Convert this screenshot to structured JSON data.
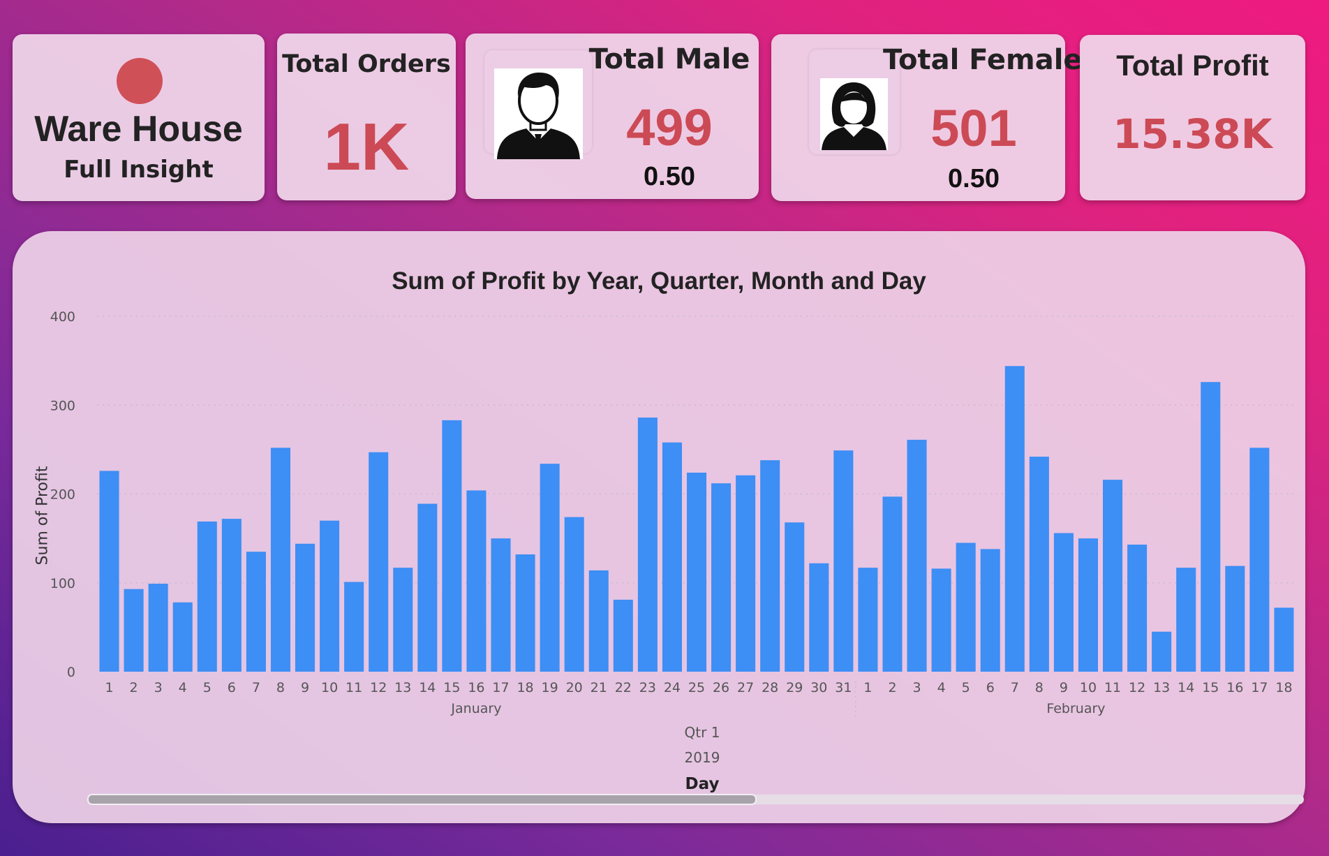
{
  "cards": {
    "warehouse": {
      "title": "Ware House",
      "subtitle": "Full Insight"
    },
    "orders": {
      "label": "Total Orders",
      "value": "1K"
    },
    "male": {
      "label": "Total Male",
      "value": "499",
      "ratio": "0.50"
    },
    "female": {
      "label": "Total Female",
      "value": "501",
      "ratio": "0.50"
    },
    "profit": {
      "label": "Total Profit",
      "value": "15.38K"
    }
  },
  "colors": {
    "accent": "#cc4a55",
    "bar": "#3d8ef5"
  },
  "icons": {
    "logo": "red-circle-icon",
    "male": "man-avatar-icon",
    "female": "woman-avatar-icon"
  },
  "chart_data": {
    "type": "bar",
    "title": "Sum of Profit by Year, Quarter, Month and Day",
    "ylabel": "Sum of Profit",
    "xlabel": "Day",
    "ylim": [
      0,
      400
    ],
    "yticks": [
      "0",
      "100",
      "200",
      "300",
      "400"
    ],
    "grid": true,
    "categories": [
      "1",
      "2",
      "3",
      "4",
      "5",
      "6",
      "7",
      "8",
      "9",
      "10",
      "11",
      "12",
      "13",
      "14",
      "15",
      "16",
      "17",
      "18",
      "19",
      "20",
      "21",
      "22",
      "23",
      "24",
      "25",
      "26",
      "27",
      "28",
      "29",
      "30",
      "31",
      "1",
      "2",
      "3",
      "4",
      "5",
      "6",
      "7",
      "8",
      "9",
      "10",
      "11",
      "12",
      "13",
      "14",
      "15",
      "16",
      "17",
      "18"
    ],
    "values": [
      226,
      93,
      99,
      78,
      169,
      172,
      135,
      252,
      144,
      170,
      101,
      247,
      117,
      189,
      283,
      204,
      150,
      132,
      234,
      174,
      114,
      81,
      286,
      258,
      224,
      212,
      221,
      238,
      168,
      122,
      249,
      117,
      197,
      261,
      116,
      145,
      138,
      344,
      242,
      156,
      150,
      216,
      143,
      45,
      117,
      326,
      119,
      252,
      72
    ],
    "months": [
      {
        "label": "January",
        "count": 31
      },
      {
        "label": "February",
        "count": 18
      }
    ],
    "quarter": "Qtr 1",
    "year": "2019"
  },
  "scrollbar": {
    "position": 0.55
  }
}
